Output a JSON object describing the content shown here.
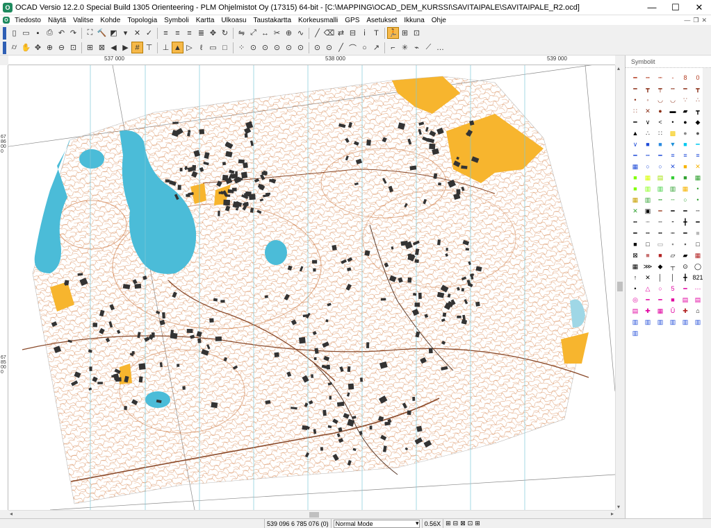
{
  "window": {
    "app_icon": "O",
    "title": "OCAD Versio 12.2.0  Special Build 1305  Orienteering - PLM Ohjelmistot Oy (17315) 64-bit - [C:\\MAPPING\\OCAD_DEM_KURSSI\\SAVITAIPALE\\SAVITAIPALE_R2.ocd]",
    "minimize": "—",
    "maximize": "☐",
    "close": "✕"
  },
  "menu": {
    "items": [
      "Tiedosto",
      "Näytä",
      "Valitse",
      "Kohde",
      "Topologia",
      "Symboli",
      "Kartta",
      "Ulkoasu",
      "Taustakartta",
      "Korkeusmalli",
      "GPS",
      "Asetukset",
      "Ikkuna",
      "Ohje"
    ],
    "mdi_minimize": "—",
    "mdi_restore": "❐",
    "mdi_close": "✕"
  },
  "toolbar1": {
    "icons": [
      "new-file-icon",
      "open-file-icon",
      "save-icon",
      "print-icon",
      "undo-icon",
      "redo-icon",
      "fit-window-icon",
      "hammer-icon",
      "color-icon",
      "dropdown-icon",
      "delete-icon",
      "check-icon",
      "align-left-icon",
      "align-center-icon",
      "align-right-icon",
      "distribute-icon",
      "move-icon",
      "rotate-icon",
      "mirror-icon",
      "scale-icon",
      "stretch-icon",
      "cut-icon",
      "join-icon",
      "smooth-icon",
      "line-icon",
      "eraser-icon",
      "reverse-icon",
      "graphic-icon",
      "info-icon",
      "text-icon",
      "runner-icon",
      "grid-icon",
      "tools-icon"
    ],
    "glyphs": [
      "▯",
      "▭",
      "▪",
      "⎙",
      "↶",
      "↷",
      "⛶",
      "🔨",
      "◩",
      "▾",
      "✕",
      "✓",
      "≡",
      "≡",
      "≡",
      "≣",
      "✥",
      "↻",
      "⇋",
      "⤢",
      "↔",
      "✂",
      "⊕",
      "∿",
      "╱",
      "⌫",
      "⇄",
      "⊟",
      "ⅰ",
      "T",
      "🏃",
      "⊞",
      "⊡"
    ]
  },
  "toolbar2": {
    "icons": [
      "binoculars-icon",
      "hand-icon",
      "pan-icon",
      "zoom-in-icon",
      "zoom-out-icon",
      "zoom-rect-icon",
      "zoom-fit-icon",
      "zoom-select-icon",
      "back-icon",
      "forward-icon",
      "grid-toggle-icon",
      "layout-icon",
      "layout2-icon",
      "select-icon",
      "select-object-icon",
      "lasso-icon",
      "rect-icon",
      "square-icon",
      "dots-icon",
      "node-icon",
      "node2-icon",
      "node3-icon",
      "node4-icon",
      "node5-icon",
      "node6-icon",
      "node7-icon",
      "straight-line-icon",
      "curve-icon",
      "circle-icon",
      "freehand-icon",
      "rectangle-line-icon",
      "star-icon",
      "path-icon",
      "measure-icon",
      "more-icon"
    ],
    "glyphs": [
      "⌭",
      "✋",
      "✥",
      "⊕",
      "⊖",
      "⊡",
      "⊞",
      "⊠",
      "◀",
      "▶",
      "#",
      "⊤",
      "⊥",
      "▲",
      "▷",
      "ℓ",
      "▭",
      "□",
      "⁘",
      "⊙",
      "⊙",
      "⊙",
      "⊙",
      "⊙",
      "⊙",
      "⊙",
      "╱",
      "⌒",
      "○",
      "↗",
      "⌐",
      "✳",
      "⌁",
      "⟋",
      "…"
    ]
  },
  "ruler": {
    "x_labels": [
      "537 000",
      "538 000",
      "539 000"
    ],
    "y_labels": [
      "6786000",
      "6785000"
    ]
  },
  "scroll": {
    "left": "◂",
    "right": "▸",
    "up": "▴",
    "down": "▾"
  },
  "status": {
    "coordinates": "539 096  6 785 076  (0)",
    "mode": "Normal Mode",
    "zoom": "0.56X"
  },
  "symbol_panel": {
    "title": "Symbolit",
    "symbols": [
      {
        "glyph": "━",
        "color": "#b23a1e",
        "name": "contour-symbol"
      },
      {
        "glyph": "┅",
        "color": "#b23a1e",
        "name": "form-line-symbol"
      },
      {
        "glyph": "┉",
        "color": "#b23a1e",
        "name": "index-contour-symbol"
      },
      {
        "glyph": "‑",
        "color": "#b23a1e",
        "name": "dash-symbol"
      },
      {
        "glyph": "8",
        "color": "#b23a1e",
        "name": "contour-value-symbol"
      },
      {
        "glyph": "0",
        "color": "#b23a1e",
        "name": "contour-value2-symbol"
      },
      {
        "glyph": "━",
        "color": "#8a2e16",
        "name": "earth-bank-symbol"
      },
      {
        "glyph": "┳",
        "color": "#8a2e16",
        "name": "earth-wall-symbol"
      },
      {
        "glyph": "┯",
        "color": "#8a2e16",
        "name": "wall-symbol"
      },
      {
        "glyph": "┅",
        "color": "#8a2e16",
        "name": "erosion-symbol"
      },
      {
        "glyph": "━",
        "color": "#8a2e16",
        "name": "gully-symbol"
      },
      {
        "glyph": "┳",
        "color": "#8a2e16",
        "name": "small-gully-symbol"
      },
      {
        "glyph": "•",
        "color": "#8a2e16",
        "name": "knoll-symbol"
      },
      {
        "glyph": "◦",
        "color": "#8a2e16",
        "name": "small-knoll-symbol"
      },
      {
        "glyph": "◡",
        "color": "#8a2e16",
        "name": "depression-symbol"
      },
      {
        "glyph": "◡",
        "color": "#8a2e16",
        "name": "small-depression-symbol"
      },
      {
        "glyph": "∵",
        "color": "#8a2e16",
        "name": "pit-symbol"
      },
      {
        "glyph": "∴",
        "color": "#8a2e16",
        "name": "broken-ground-symbol"
      },
      {
        "glyph": "∷",
        "color": "#8a2e16",
        "name": "very-broken-symbol"
      },
      {
        "glyph": "✕",
        "color": "#8a2e16",
        "name": "earth-feature-symbol"
      },
      {
        "glyph": "●",
        "color": "#8a2e16",
        "name": "special-earth-symbol"
      },
      {
        "glyph": "▬",
        "color": "#000000",
        "name": "cliff-symbol"
      },
      {
        "glyph": "▰",
        "color": "#000000",
        "name": "rock-pillar-symbol"
      },
      {
        "glyph": "┳",
        "color": "#000000",
        "name": "impassable-cliff-symbol"
      },
      {
        "glyph": "━",
        "color": "#000000",
        "name": "rocky-line-symbol"
      },
      {
        "glyph": "∨",
        "color": "#000000",
        "name": "rock-pit-symbol"
      },
      {
        "glyph": "<",
        "color": "#000000",
        "name": "cave-symbol"
      },
      {
        "glyph": "•",
        "color": "#000000",
        "name": "boulder-symbol"
      },
      {
        "glyph": "●",
        "color": "#000000",
        "name": "large-boulder-symbol"
      },
      {
        "glyph": "◆",
        "color": "#000000",
        "name": "giant-boulder-symbol"
      },
      {
        "glyph": "▲",
        "color": "#000000",
        "name": "boulder-field-symbol"
      },
      {
        "glyph": "∴",
        "color": "#000000",
        "name": "boulder-cluster-symbol"
      },
      {
        "glyph": "∷",
        "color": "#000000",
        "name": "stony-ground-symbol"
      },
      {
        "glyph": "▩",
        "color": "#f6c800",
        "name": "sandy-ground-symbol"
      },
      {
        "glyph": "●",
        "color": "#888888",
        "name": "bare-rock-symbol"
      },
      {
        "glyph": "●",
        "color": "#555555",
        "name": "trench-symbol"
      },
      {
        "glyph": "∨",
        "color": "#1e4bd8",
        "name": "water-feature-symbol"
      },
      {
        "glyph": "■",
        "color": "#1e4bd8",
        "name": "water-symbol"
      },
      {
        "glyph": "■",
        "color": "#2a8be0",
        "name": "shallow-water-symbol"
      },
      {
        "glyph": "▼",
        "color": "#1e90d8",
        "name": "pond-symbol"
      },
      {
        "glyph": "■",
        "color": "#00c8f0",
        "name": "waterhole-symbol"
      },
      {
        "glyph": "━",
        "color": "#00c8f0",
        "name": "river-symbol"
      },
      {
        "glyph": "━",
        "color": "#1e4bd8",
        "name": "stream-symbol"
      },
      {
        "glyph": "┅",
        "color": "#1e4bd8",
        "name": "ditch-symbol"
      },
      {
        "glyph": "━",
        "color": "#1e4bd8",
        "name": "narrow-marsh-symbol"
      },
      {
        "glyph": "≡",
        "color": "#1e4bd8",
        "name": "marsh-symbol"
      },
      {
        "glyph": "≡",
        "color": "#1e4bd8",
        "name": "indistinct-marsh-symbol"
      },
      {
        "glyph": "≡",
        "color": "#1e4bd8",
        "name": "uncrossable-marsh-symbol"
      },
      {
        "glyph": "▦",
        "color": "#1e4bd8",
        "name": "spring-symbol"
      },
      {
        "glyph": "○",
        "color": "#1e4bd8",
        "name": "well-symbol"
      },
      {
        "glyph": "○",
        "color": "#1e4bd8",
        "name": "water-tank-symbol"
      },
      {
        "glyph": "✕",
        "color": "#1e4bd8",
        "name": "special-water-symbol"
      },
      {
        "glyph": "■",
        "color": "#f6b300",
        "name": "open-land-symbol"
      },
      {
        "glyph": "✕",
        "color": "#f6b300",
        "name": "open-scattered-symbol"
      },
      {
        "glyph": "■",
        "color": "#7fff00",
        "name": "rough-open-symbol"
      },
      {
        "glyph": "▦",
        "color": "#d8ff00",
        "name": "undergrowth-symbol"
      },
      {
        "glyph": "▤",
        "color": "#a0e000",
        "name": "vegetation-slow-symbol"
      },
      {
        "glyph": "■",
        "color": "#33cc33",
        "name": "vegetation-walk-symbol"
      },
      {
        "glyph": "■",
        "color": "#2ea02e",
        "name": "vegetation-fight-symbol"
      },
      {
        "glyph": "▦",
        "color": "#2ea02e",
        "name": "vegetation-dense-symbol"
      },
      {
        "glyph": "■",
        "color": "#7fff00",
        "name": "orchard-symbol"
      },
      {
        "glyph": "▥",
        "color": "#7fff00",
        "name": "vineyard-symbol"
      },
      {
        "glyph": "▥",
        "color": "#33cc33",
        "name": "cultivated-symbol"
      },
      {
        "glyph": "▥",
        "color": "#2ea02e",
        "name": "forest-runnable-symbol"
      },
      {
        "glyph": "▦",
        "color": "#f6b300",
        "name": "field-symbol"
      },
      {
        "glyph": "•",
        "color": "#2ea02e",
        "name": "tree-symbol"
      },
      {
        "glyph": "▦",
        "color": "#c8a000",
        "name": "distinct-cultivation-symbol"
      },
      {
        "glyph": "▥",
        "color": "#2ea02e",
        "name": "vegetation-boundary-symbol"
      },
      {
        "glyph": "┅",
        "color": "#2ea02e",
        "name": "cultivation-boundary-symbol"
      },
      {
        "glyph": "╌",
        "color": "#2ea02e",
        "name": "special-vegetation-symbol"
      },
      {
        "glyph": "○",
        "color": "#2ea02e",
        "name": "small-tree-symbol"
      },
      {
        "glyph": "•",
        "color": "#2ea02e",
        "name": "bush-symbol"
      },
      {
        "glyph": "✕",
        "color": "#2ea02e",
        "name": "special-veg-x-symbol"
      },
      {
        "glyph": "▣",
        "color": "#000000",
        "name": "paved-area-symbol"
      },
      {
        "glyph": "━",
        "color": "#a04a30",
        "name": "motorway-symbol"
      },
      {
        "glyph": "━",
        "color": "#000000",
        "name": "major-road-symbol"
      },
      {
        "glyph": "━",
        "color": "#000000",
        "name": "minor-road-symbol"
      },
      {
        "glyph": "╌",
        "color": "#000000",
        "name": "road-symbol"
      },
      {
        "glyph": "╍",
        "color": "#000000",
        "name": "vehicle-track-symbol"
      },
      {
        "glyph": "┈",
        "color": "#000000",
        "name": "footpath-symbol"
      },
      {
        "glyph": "╌",
        "color": "#000000",
        "name": "small-path-symbol"
      },
      {
        "glyph": "⁃",
        "color": "#000000",
        "name": "less-distinct-path-symbol"
      },
      {
        "glyph": "╋",
        "color": "#000000",
        "name": "narrow-ride-symbol"
      },
      {
        "glyph": "━",
        "color": "#000000",
        "name": "railway-symbol"
      },
      {
        "glyph": "━",
        "color": "#000000",
        "name": "power-line-symbol"
      },
      {
        "glyph": "┅",
        "color": "#000000",
        "name": "major-power-line-symbol"
      },
      {
        "glyph": "╍",
        "color": "#000000",
        "name": "tunnel-symbol"
      },
      {
        "glyph": "┉",
        "color": "#000000",
        "name": "stone-wall-symbol"
      },
      {
        "glyph": "━",
        "color": "#000000",
        "name": "ruined-wall-symbol"
      },
      {
        "glyph": "■",
        "color": "#b8b8b8",
        "name": "impassable-wall-symbol"
      },
      {
        "glyph": "■",
        "color": "#000000",
        "name": "building-symbol"
      },
      {
        "glyph": "□",
        "color": "#000000",
        "name": "fence-symbol"
      },
      {
        "glyph": "▭",
        "color": "#888888",
        "name": "ruined-fence-symbol"
      },
      {
        "glyph": "▪",
        "color": "#888888",
        "name": "high-tower-symbol"
      },
      {
        "glyph": "▪",
        "color": "#555555",
        "name": "small-tower-symbol"
      },
      {
        "glyph": "□",
        "color": "#000000",
        "name": "cairn-symbol"
      },
      {
        "glyph": "⊠",
        "color": "#000000",
        "name": "fodder-rack-symbol"
      },
      {
        "glyph": "■",
        "color": "#c87070",
        "name": "settlement-symbol"
      },
      {
        "glyph": "■",
        "color": "#b22222",
        "name": "permanent-forbidden-symbol"
      },
      {
        "glyph": "▱",
        "color": "#000000",
        "name": "pipeline-symbol"
      },
      {
        "glyph": "▰",
        "color": "#000000",
        "name": "high-pipeline-symbol"
      },
      {
        "glyph": "▦",
        "color": "#b22222",
        "name": "forbidden-area-symbol"
      },
      {
        "glyph": "▦",
        "color": "#000000",
        "name": "forbidden-route-symbol"
      },
      {
        "glyph": "⋙",
        "color": "#000000",
        "name": "crossing-symbol"
      },
      {
        "glyph": "◆",
        "color": "#000000",
        "name": "special-man-symbol"
      },
      {
        "glyph": "┬",
        "color": "#000000",
        "name": "grid-marker-symbol"
      },
      {
        "glyph": "⊙",
        "color": "#000000",
        "name": "special-point-symbol"
      },
      {
        "glyph": "◯",
        "color": "#000000",
        "name": "special-circle-symbol"
      },
      {
        "glyph": "↑",
        "color": "#000000",
        "name": "north-arrow-symbol"
      },
      {
        "glyph": "✕",
        "color": "#000000",
        "name": "cross-symbol"
      },
      {
        "glyph": "│",
        "color": "#000000",
        "name": "magnetic-north-symbol"
      },
      {
        "glyph": "│",
        "color": "#000000",
        "name": "magnetic-north2-symbol"
      },
      {
        "glyph": "╋",
        "color": "#000000",
        "name": "registration-symbol"
      },
      {
        "glyph": "821",
        "color": "#000000",
        "name": "spot-height-symbol"
      },
      {
        "glyph": "•",
        "color": "#000000",
        "name": "height-point-symbol"
      },
      {
        "glyph": "△",
        "color": "#e000a0",
        "name": "start-symbol"
      },
      {
        "glyph": "○",
        "color": "#e000a0",
        "name": "control-symbol"
      },
      {
        "glyph": "5",
        "color": "#e000a0",
        "name": "control-number-symbol"
      },
      {
        "glyph": "━",
        "color": "#e000a0",
        "name": "course-line-symbol"
      },
      {
        "glyph": "⋯",
        "color": "#e000a0",
        "name": "marked-route-symbol"
      },
      {
        "glyph": "◎",
        "color": "#e000a0",
        "name": "finish-symbol"
      },
      {
        "glyph": "━",
        "color": "#e000a0",
        "name": "crossing-point-symbol"
      },
      {
        "glyph": "━",
        "color": "#e000a0",
        "name": "out-of-bounds-symbol"
      },
      {
        "glyph": "■",
        "color": "#e000a0",
        "name": "forbidden-course-symbol"
      },
      {
        "glyph": "▤",
        "color": "#e000a0",
        "name": "dangerous-area-symbol"
      },
      {
        "glyph": "▤",
        "color": "#e000a0",
        "name": "forbidden-crossing-symbol"
      },
      {
        "glyph": "▤",
        "color": "#e000a0",
        "name": "first-aid-symbol"
      },
      {
        "glyph": "✚",
        "color": "#e000a0",
        "name": "refreshment-symbol"
      },
      {
        "glyph": "▦",
        "color": "#e000a0",
        "name": "temporary-construction-symbol"
      },
      {
        "glyph": "Ū",
        "color": "#e000a0",
        "name": "water-point-symbol"
      },
      {
        "glyph": "✚",
        "color": "#b22222",
        "name": "compass-rose-symbol"
      },
      {
        "glyph": "⌂",
        "color": "#000000",
        "name": "logo-symbol"
      },
      {
        "glyph": "▥",
        "color": "#1e4bd8",
        "name": "text-frame-symbol"
      },
      {
        "glyph": "▥",
        "color": "#1e4bd8",
        "name": "text-frame2-symbol"
      },
      {
        "glyph": "▥",
        "color": "#1e4bd8",
        "name": "text-frame3-symbol"
      },
      {
        "glyph": "▥",
        "color": "#1e4bd8",
        "name": "text-frame4-symbol"
      },
      {
        "glyph": "▥",
        "color": "#1e4bd8",
        "name": "text-frame5-symbol"
      },
      {
        "glyph": "▥",
        "color": "#1e4bd8",
        "name": "text-frame6-symbol"
      },
      {
        "glyph": "▥",
        "color": "#1e4bd8",
        "name": "text-frame7-symbol"
      }
    ]
  },
  "colors": {
    "water": "#4bbcd8",
    "open_land": "#f7b52e",
    "contour": "#cf6d2a",
    "building": "#333333",
    "grid_line": "#7fc8d8",
    "map_outline": "#888888"
  }
}
